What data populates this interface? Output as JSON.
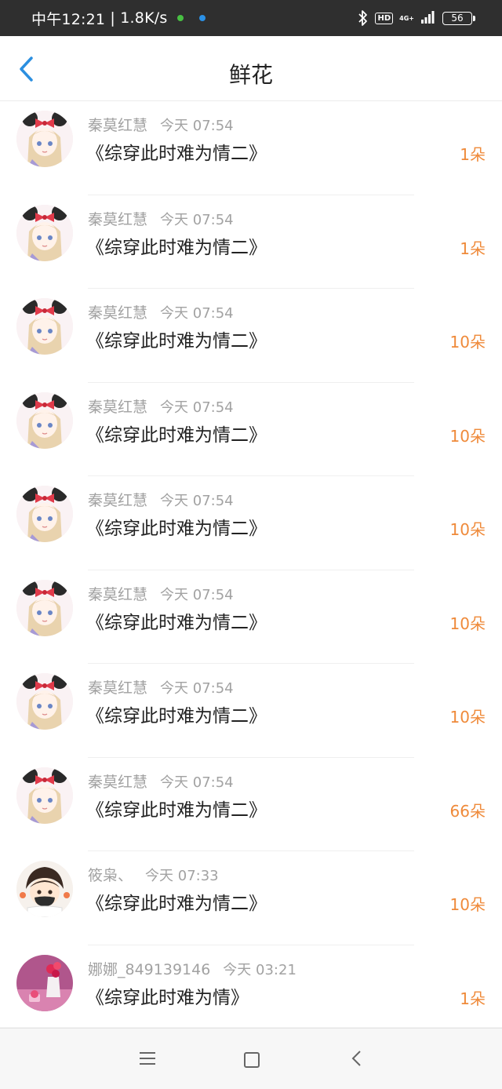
{
  "status_bar": {
    "time": "中午12:21",
    "speed": "1.8K/s",
    "hd": "HD",
    "net_type": "4G+",
    "battery": "56"
  },
  "header": {
    "title": "鲜花"
  },
  "items": [
    {
      "user": "秦莫红慧",
      "time": "今天 07:54",
      "book": "《综穿此时难为情二》",
      "count": "1朵",
      "avatar": "girl-minnie"
    },
    {
      "user": "秦莫红慧",
      "time": "今天 07:54",
      "book": "《综穿此时难为情二》",
      "count": "1朵",
      "avatar": "girl-minnie"
    },
    {
      "user": "秦莫红慧",
      "time": "今天 07:54",
      "book": "《综穿此时难为情二》",
      "count": "10朵",
      "avatar": "girl-minnie"
    },
    {
      "user": "秦莫红慧",
      "time": "今天 07:54",
      "book": "《综穿此时难为情二》",
      "count": "10朵",
      "avatar": "girl-minnie"
    },
    {
      "user": "秦莫红慧",
      "time": "今天 07:54",
      "book": "《综穿此时难为情二》",
      "count": "10朵",
      "avatar": "girl-minnie"
    },
    {
      "user": "秦莫红慧",
      "time": "今天 07:54",
      "book": "《综穿此时难为情二》",
      "count": "10朵",
      "avatar": "girl-minnie"
    },
    {
      "user": "秦莫红慧",
      "time": "今天 07:54",
      "book": "《综穿此时难为情二》",
      "count": "10朵",
      "avatar": "girl-minnie"
    },
    {
      "user": "秦莫红慧",
      "time": "今天 07:54",
      "book": "《综穿此时难为情二》",
      "count": "66朵",
      "avatar": "girl-minnie"
    },
    {
      "user": "筱枭、",
      "time": "今天 07:33",
      "book": "《综穿此时难为情二》",
      "count": "10朵",
      "avatar": "masked-boy"
    },
    {
      "user": "娜娜_849139146",
      "time": "今天 03:21",
      "book": "《综穿此时难为情》",
      "count": "1朵",
      "avatar": "pink-flowers"
    }
  ],
  "colors": {
    "accent": "#2b8fe0",
    "count": "#ef8a3a",
    "meta": "#a2a2a2",
    "title": "#222222"
  },
  "nav_icons": [
    "menu-icon",
    "home-icon",
    "back-icon"
  ]
}
